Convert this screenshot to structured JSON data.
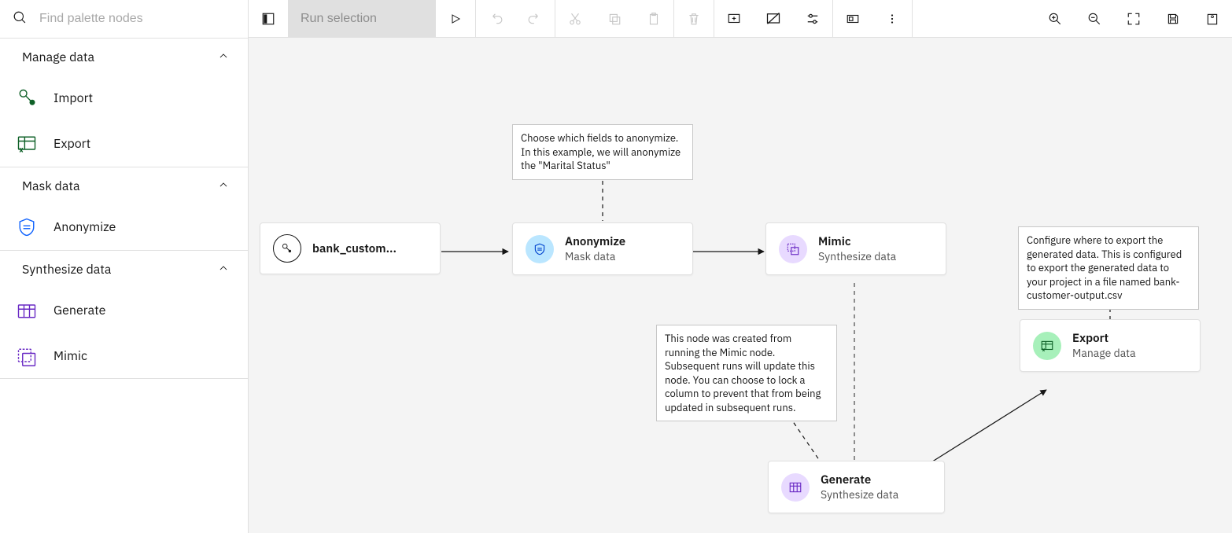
{
  "search": {
    "placeholder": "Find palette nodes"
  },
  "toolbar": {
    "run_selection_label": "Run selection"
  },
  "sidebar": {
    "sections": [
      {
        "label": "Manage data",
        "items": [
          {
            "label": "Import",
            "icon": "import-icon"
          },
          {
            "label": "Export",
            "icon": "export-icon"
          }
        ]
      },
      {
        "label": "Mask data",
        "items": [
          {
            "label": "Anonymize",
            "icon": "anonymize-icon"
          }
        ]
      },
      {
        "label": "Synthesize data",
        "items": [
          {
            "label": "Generate",
            "icon": "generate-icon"
          },
          {
            "label": "Mimic",
            "icon": "mimic-icon"
          }
        ]
      }
    ]
  },
  "flow": {
    "nodes": {
      "source": {
        "title": "bank_custom...",
        "subtitle": ""
      },
      "anonymize": {
        "title": "Anonymize",
        "subtitle": "Mask data"
      },
      "mimic": {
        "title": "Mimic",
        "subtitle": "Synthesize data"
      },
      "generate": {
        "title": "Generate",
        "subtitle": "Synthesize data"
      },
      "export": {
        "title": "Export",
        "subtitle": "Manage data"
      }
    },
    "comments": {
      "anonymize_note": "Choose which fields to anonymize. In this example, we will anonymize the \"Marital Status\"",
      "generate_note": "This node was created from running the Mimic node. Subsequent runs will update this node. You can choose to lock a column to prevent that from being updated in subsequent runs.",
      "export_note": "Configure where to export the generated data. This is configured to export the generated data to your project in a file named bank-customer-output.csv"
    }
  }
}
